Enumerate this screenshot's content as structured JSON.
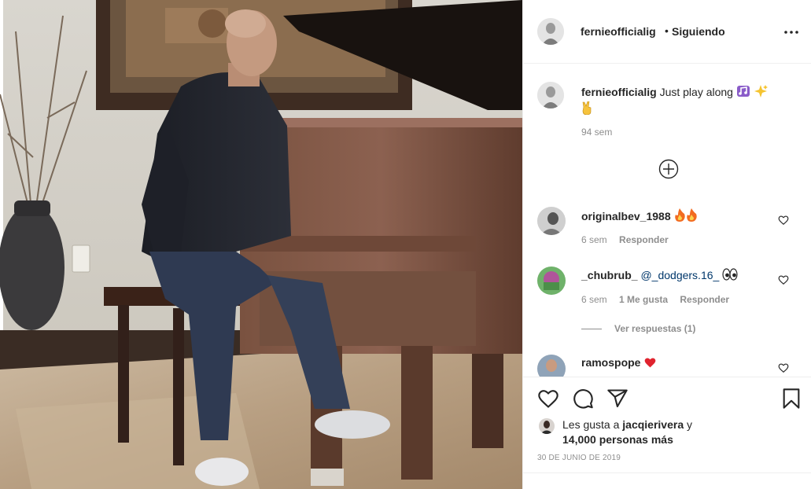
{
  "post": {
    "username": "fernieofficialig",
    "dot": "•",
    "follow_label": "Siguiendo"
  },
  "caption": {
    "username": "fernieofficialig",
    "text": "Just play along",
    "emojis": [
      "musical-notes",
      "sparkles",
      "victory-hand"
    ],
    "time": "94 sem"
  },
  "comments": [
    {
      "username": "originalbev_1988",
      "text": "",
      "emojis": [
        "fire",
        "fire"
      ],
      "time": "6 sem",
      "likes": "",
      "reply_label": "Responder"
    },
    {
      "username": "_chubrub_",
      "mention": "@_dodgers.16_",
      "emojis": [
        "eyes"
      ],
      "time": "6 sem",
      "likes": "1 Me gusta",
      "reply_label": "Responder"
    },
    {
      "username": "ramospope",
      "text": "",
      "emojis": [
        "red-heart"
      ],
      "time": "",
      "likes": "",
      "reply_label": ""
    }
  ],
  "view_replies": "Ver respuestas (1)",
  "likes": {
    "prefix": "Les gusta a",
    "user": "jacqierivera",
    "conj": "y",
    "count": "14,000 personas más"
  },
  "date": "30 DE JUNIO DE 2019",
  "icons": {
    "header": [
      "more-options-icon"
    ],
    "actions": [
      "heart-icon",
      "comment-icon",
      "share-icon",
      "bookmark-icon"
    ],
    "load_more": "plus-circle-icon",
    "comment_like": "heart-outline-icon"
  },
  "colors": {
    "text": "#262626",
    "muted": "#8e8e8e",
    "mention": "#00376b",
    "border": "#efefef"
  }
}
